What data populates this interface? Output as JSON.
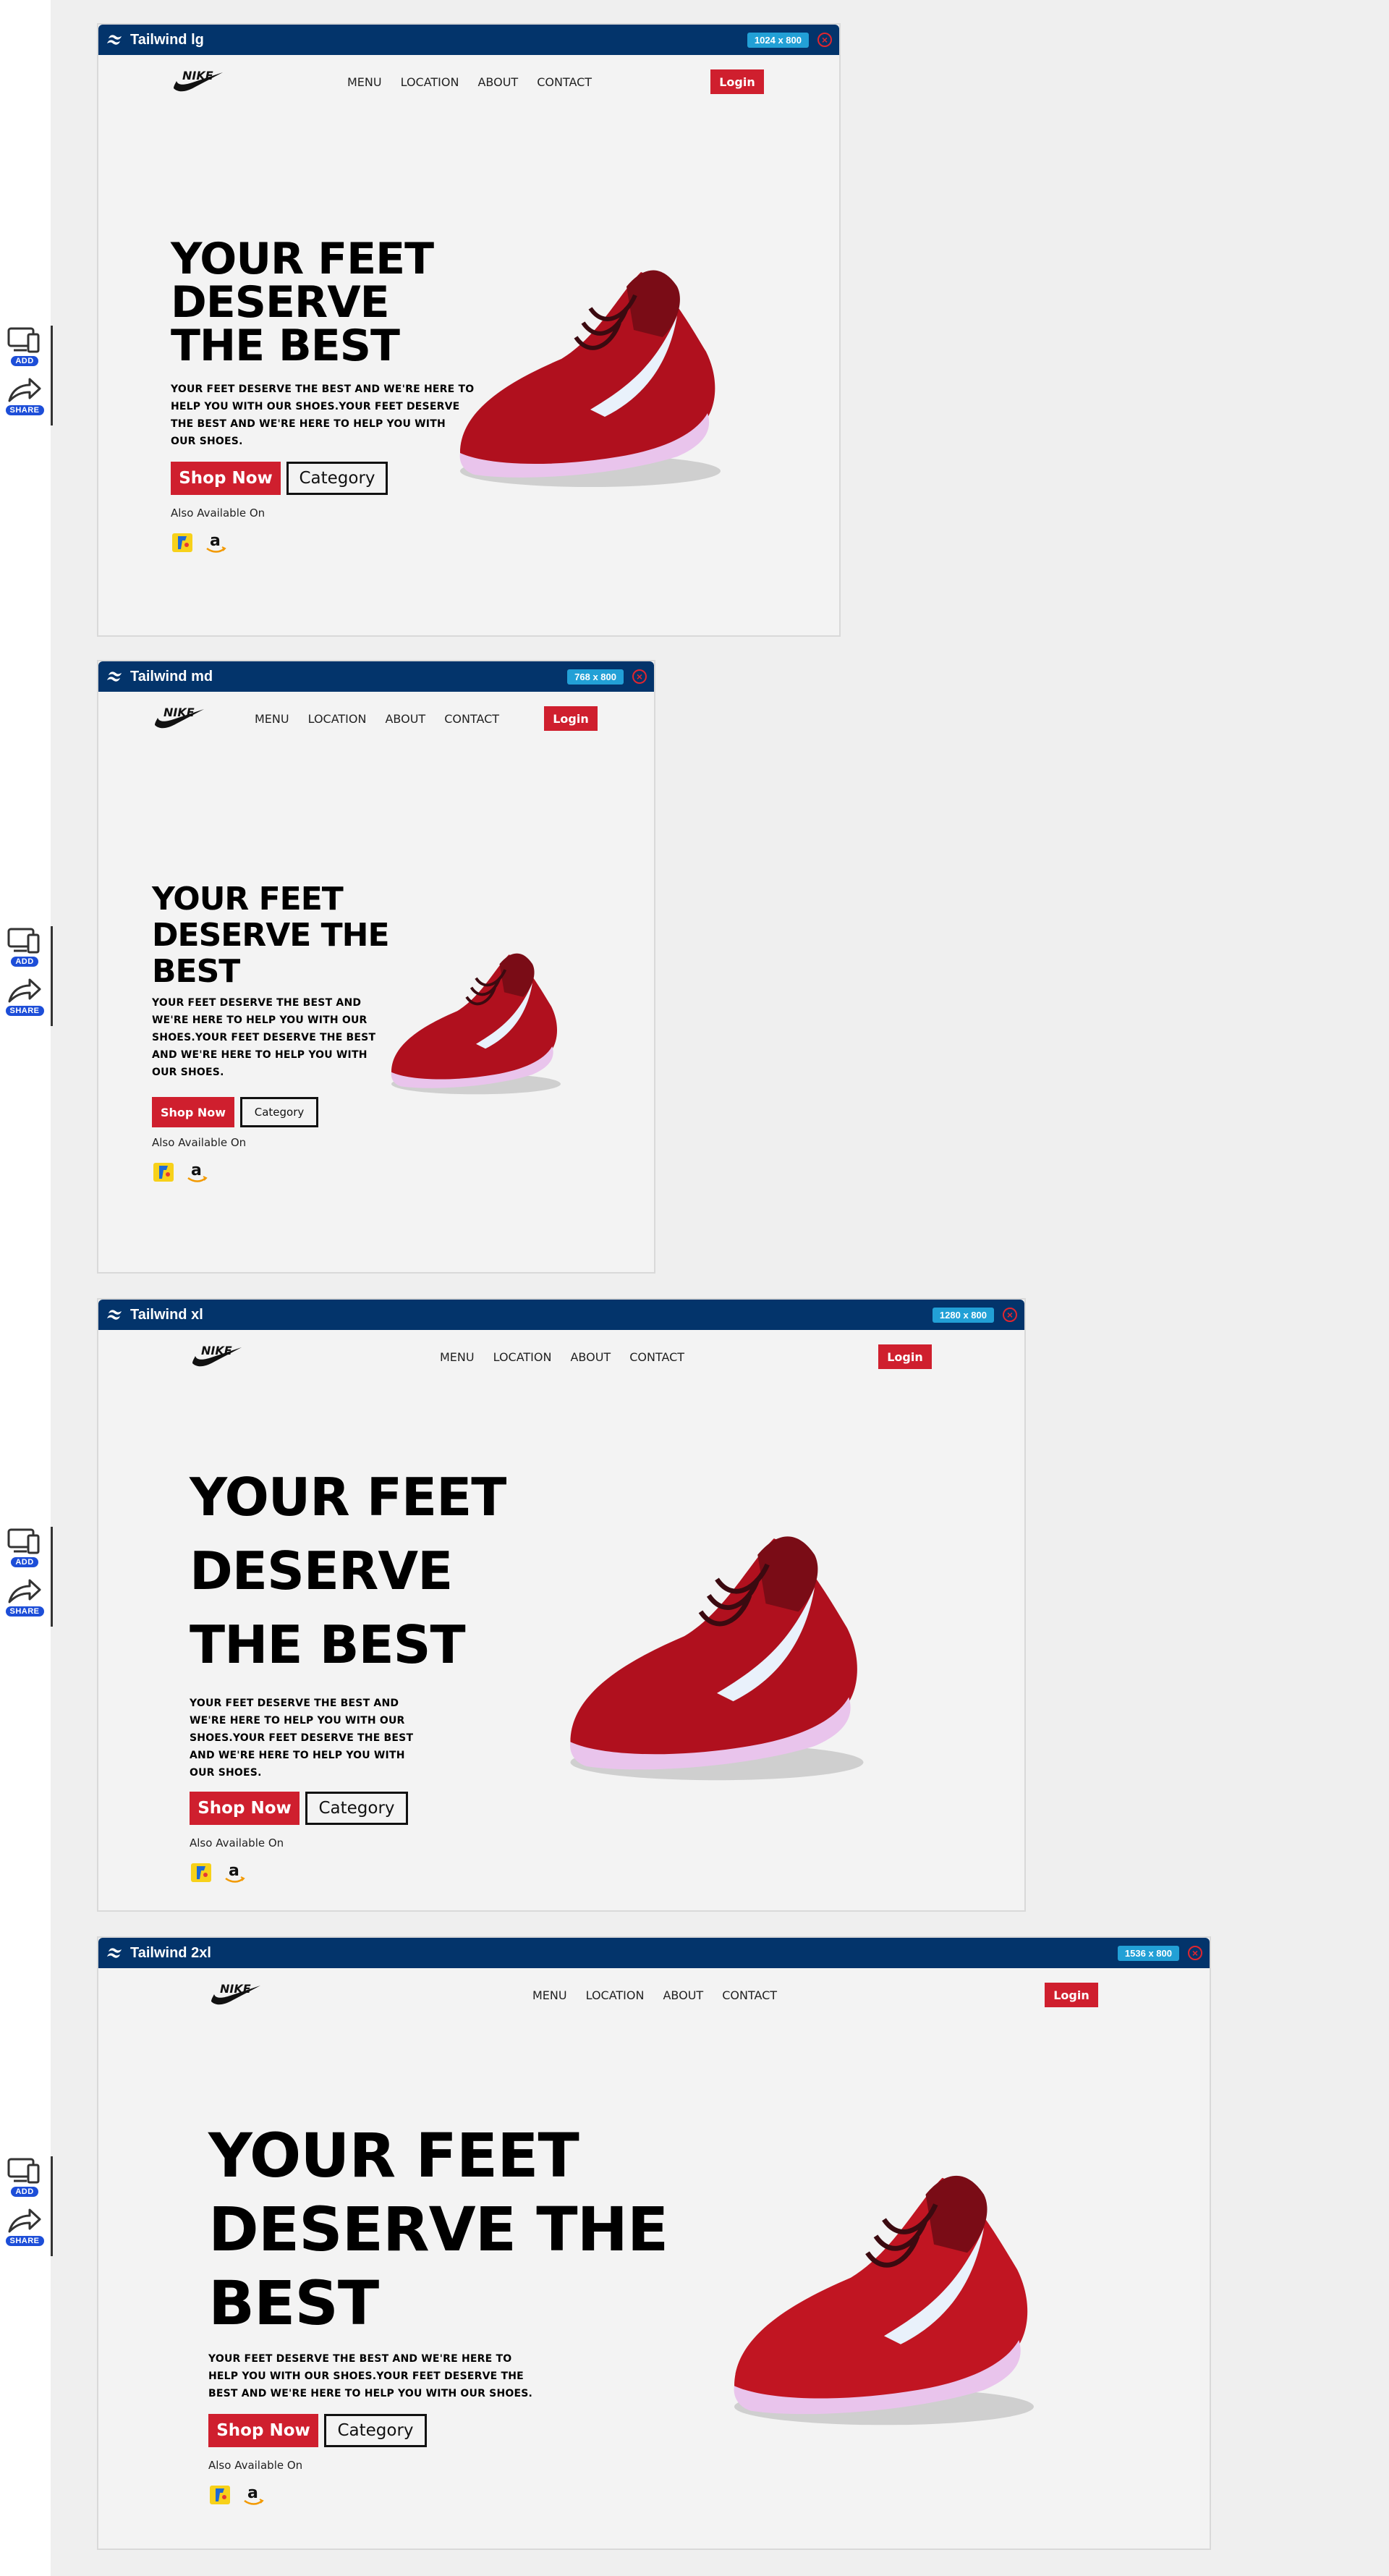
{
  "side_tools": {
    "add_label": "ADD",
    "share_label": "SHARE"
  },
  "frames": [
    {
      "name": "Tailwind lg",
      "size": "1024 x 800",
      "nav": {
        "menu": [
          "MENU",
          "LOCATION",
          "ABOUT",
          "CONTACT"
        ],
        "login": "Login"
      },
      "hero": {
        "title_lines": [
          "YOUR FEET",
          "DESERVE",
          "THE BEST"
        ],
        "text_lines": [
          "YOUR FEET DESERVE THE BEST AND WE'RE HERE TO",
          "HELP YOU WITH OUR SHOES.YOUR FEET DESERVE",
          "THE BEST AND WE'RE HERE TO HELP YOU WITH",
          "OUR SHOES."
        ],
        "shop": "Shop Now",
        "category": "Category",
        "available": "Also Available On"
      }
    },
    {
      "name": "Tailwind md",
      "size": "768 x 800",
      "nav": {
        "menu": [
          "MENU",
          "LOCATION",
          "ABOUT",
          "CONTACT"
        ],
        "login": "Login"
      },
      "hero": {
        "title_lines": [
          "YOUR FEET",
          "DESERVE THE",
          "BEST"
        ],
        "text_lines": [
          "YOUR FEET DESERVE THE BEST AND",
          "WE'RE HERE TO HELP YOU WITH OUR",
          "SHOES.YOUR FEET DESERVE THE BEST",
          "AND WE'RE HERE TO HELP YOU WITH",
          "OUR SHOES."
        ],
        "shop": "Shop Now",
        "category": "Category",
        "available": "Also Available On"
      }
    },
    {
      "name": "Tailwind xl",
      "size": "1280 x 800",
      "nav": {
        "menu": [
          "MENU",
          "LOCATION",
          "ABOUT",
          "CONTACT"
        ],
        "login": "Login"
      },
      "hero": {
        "title_lines": [
          "YOUR FEET",
          "DESERVE",
          "THE BEST"
        ],
        "text_lines": [
          "YOUR FEET DESERVE THE BEST AND",
          "WE'RE HERE TO HELP YOU WITH OUR",
          "SHOES.YOUR FEET DESERVE THE BEST",
          "AND WE'RE HERE TO HELP YOU WITH",
          "OUR SHOES."
        ],
        "shop": "Shop Now",
        "category": "Category",
        "available": "Also Available On"
      }
    },
    {
      "name": "Tailwind 2xl",
      "size": "1536 x 800",
      "nav": {
        "menu": [
          "MENU",
          "LOCATION",
          "ABOUT",
          "CONTACT"
        ],
        "login": "Login"
      },
      "hero": {
        "title_lines": [
          "YOUR FEET",
          "DESERVE THE",
          "BEST"
        ],
        "text_lines": [
          "YOUR FEET DESERVE THE BEST AND WE'RE HERE TO",
          "HELP YOU WITH OUR SHOES.YOUR FEET DESERVE THE",
          "BEST AND WE'RE HERE TO HELP YOU WITH OUR SHOES."
        ],
        "shop": "Shop Now",
        "category": "Category",
        "available": "Also Available On"
      }
    }
  ],
  "colors": {
    "frame_bar": "#03346b",
    "brand_red": "#cf1f2e",
    "badge": "#22a0d6",
    "background": "#efefef"
  }
}
